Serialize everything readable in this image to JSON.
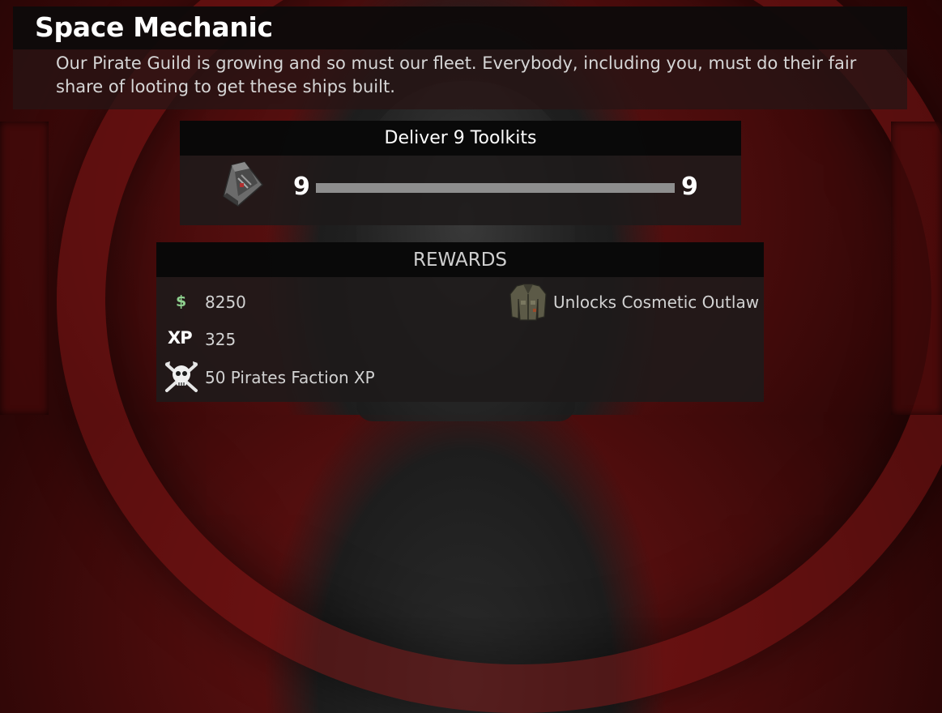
{
  "quest": {
    "title": "Space Mechanic",
    "description": "Our Pirate Guild is growing and so must our fleet. Everybody, including you, must do their fair share of looting to get these ships built."
  },
  "objective": {
    "label": "Deliver 9 Toolkits",
    "item_icon": "toolkit-icon",
    "current": "9",
    "required": "9",
    "progress_fraction": 1.0
  },
  "rewards": {
    "header": "REWARDS",
    "money": {
      "icon_label": "$",
      "amount": "8250",
      "color": "#8fd18f"
    },
    "xp": {
      "icon_label": "XP",
      "amount": "325"
    },
    "faction": {
      "icon": "pirate-skull-icon",
      "label": "50 Pirates Faction XP"
    },
    "cosmetic": {
      "icon": "jacket-icon",
      "label": "Unlocks Cosmetic Outlaw"
    }
  }
}
